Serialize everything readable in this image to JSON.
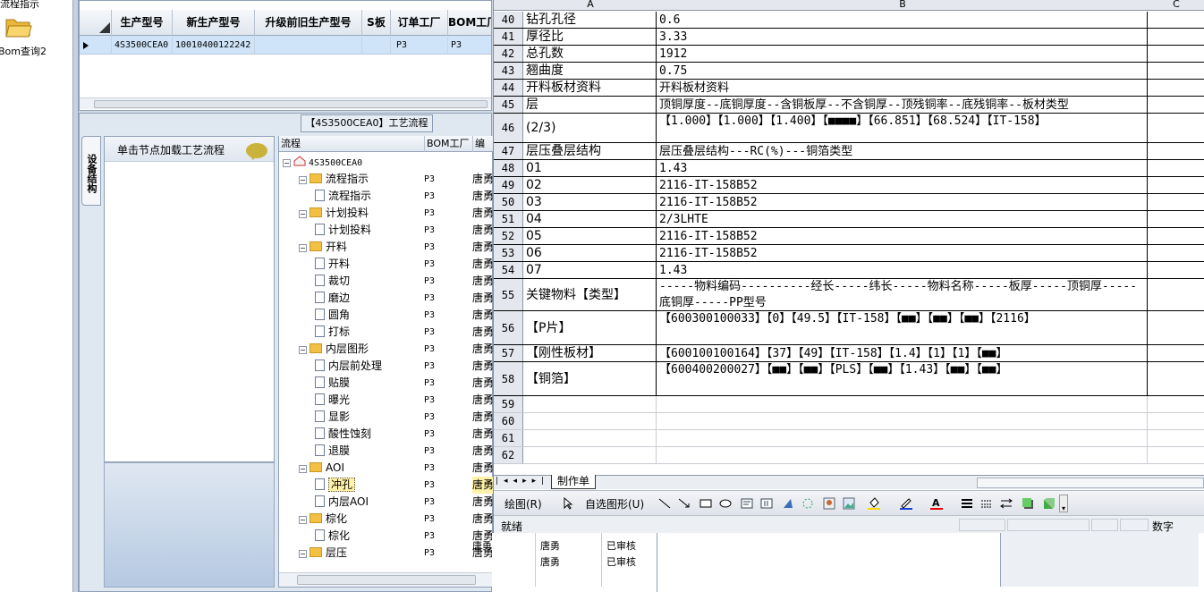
{
  "left_nav": {
    "item1": "流程指示",
    "item2": "Bom查询2"
  },
  "top_grid": {
    "columns": [
      "生产型号",
      "新生产型号",
      "升级前旧生产型号",
      "S板",
      "订单工厂",
      "BOM工厂"
    ],
    "row": {
      "prod_model": "4S3500CEA0",
      "new_model": "10010400122242",
      "old_model": "",
      "s_board": "",
      "order_factory": "P3",
      "bom_factory": "P3"
    }
  },
  "process_tab": "【4S3500CEA0】工艺流程",
  "vertical_tab": "设备结构",
  "load_panel_label": "单击节点加载工艺流程",
  "tree": {
    "headers": [
      "流程",
      "BOM工厂",
      "编"
    ],
    "root": "4S3500CEA0",
    "col3": "唐勇",
    "rows": [
      {
        "label": "流程指示",
        "type": "folder",
        "fac": "P3"
      },
      {
        "label": "流程指示",
        "type": "doc",
        "fac": "P3"
      },
      {
        "label": "计划投料",
        "type": "folder",
        "fac": "P3"
      },
      {
        "label": "计划投料",
        "type": "doc",
        "fac": "P3"
      },
      {
        "label": "开料",
        "type": "folder",
        "fac": "P3"
      },
      {
        "label": "开料",
        "type": "doc",
        "fac": "P3"
      },
      {
        "label": "裁切",
        "type": "doc",
        "fac": "P3"
      },
      {
        "label": "磨边",
        "type": "doc",
        "fac": "P3"
      },
      {
        "label": "圆角",
        "type": "doc",
        "fac": "P3"
      },
      {
        "label": "打标",
        "type": "doc",
        "fac": "P3"
      },
      {
        "label": "内层图形",
        "type": "folder",
        "fac": "P3"
      },
      {
        "label": "内层前处理",
        "type": "doc",
        "fac": "P3"
      },
      {
        "label": "贴膜",
        "type": "doc",
        "fac": "P3"
      },
      {
        "label": "曝光",
        "type": "doc",
        "fac": "P3"
      },
      {
        "label": "显影",
        "type": "doc",
        "fac": "P3"
      },
      {
        "label": "酸性蚀刻",
        "type": "doc",
        "fac": "P3"
      },
      {
        "label": "退膜",
        "type": "doc",
        "fac": "P3"
      },
      {
        "label": "AOI",
        "type": "folder",
        "fac": "P3"
      },
      {
        "label": "冲孔",
        "type": "doc",
        "fac": "P3",
        "selected": true
      },
      {
        "label": "内层AOI",
        "type": "doc",
        "fac": "P3"
      },
      {
        "label": "棕化",
        "type": "folder",
        "fac": "P3"
      },
      {
        "label": "棕化",
        "type": "doc",
        "fac": "P3"
      },
      {
        "label": "层压",
        "type": "folder",
        "fac": "P3"
      }
    ],
    "extra": {
      "c4": "唐勇",
      "c5": "已审核"
    }
  },
  "excel": {
    "columns": [
      "A",
      "B",
      "C"
    ],
    "rows": [
      {
        "n": "40",
        "a": "钻孔孔径",
        "b": "0.6"
      },
      {
        "n": "41",
        "a": "厚径比",
        "b": "3.33"
      },
      {
        "n": "42",
        "a": "总孔数",
        "b": "1912"
      },
      {
        "n": "43",
        "a": "翘曲度",
        "b": "0.75"
      },
      {
        "n": "44",
        "a": "开料板材资料",
        "b": "开料板材资料"
      },
      {
        "n": "45",
        "a": "层",
        "b": "顶铜厚度--底铜厚度--含铜板厚--不含铜厚--顶残铜率--底残铜率--板材类型"
      },
      {
        "n": "46",
        "a": "(2/3)",
        "b": "【1.000】【1.000】【1.400】【■■■■】【66.851】【68.524】【IT-158】"
      },
      {
        "n": "47",
        "a": "层压叠层结构",
        "b": "层压叠层结构---RC(%)---铜箔类型"
      },
      {
        "n": "48",
        "a": "01",
        "b": "1.43"
      },
      {
        "n": "49",
        "a": "02",
        "b": "2116-IT-158B52"
      },
      {
        "n": "50",
        "a": "03",
        "b": "2116-IT-158B52"
      },
      {
        "n": "51",
        "a": "04",
        "b": "2/3LHTE"
      },
      {
        "n": "52",
        "a": "05",
        "b": "2116-IT-158B52"
      },
      {
        "n": "53",
        "a": "06",
        "b": "2116-IT-158B52"
      },
      {
        "n": "54",
        "a": "07",
        "b": "1.43"
      },
      {
        "n": "55",
        "a": "关键物料【类型】",
        "b": "-----物料编码----------经长-----纬长-----物料名称-----板厚-----顶铜厚-----底铜厚-----PP型号"
      },
      {
        "n": "56",
        "a": "【P片】",
        "b": "【600300100033】【0】【49.5】【IT-158】【■■】【■■】【■■】【2116】"
      },
      {
        "n": "57",
        "a": "【刚性板材】",
        "b": "【600100100164】【37】【49】【IT-158】【1.4】【1】【1】【■■】"
      },
      {
        "n": "58",
        "a": "【铜箔】",
        "b": "【600400200027】【■■】【■■】【PLS】【■■】【1.43】【■■】【■■】"
      },
      {
        "n": "59",
        "a": "",
        "b": ""
      },
      {
        "n": "60",
        "a": "",
        "b": ""
      },
      {
        "n": "61",
        "a": "",
        "b": ""
      },
      {
        "n": "62",
        "a": "",
        "b": ""
      }
    ],
    "sheet_tab": "制作单",
    "draw_label": "绘图(R)",
    "autoshape_label": "自选图形(U)",
    "status": "就绪",
    "numlock": "数字"
  },
  "bg_table": {
    "c1": "唐勇",
    "c2": "唐勇",
    "c3": "已审核"
  }
}
